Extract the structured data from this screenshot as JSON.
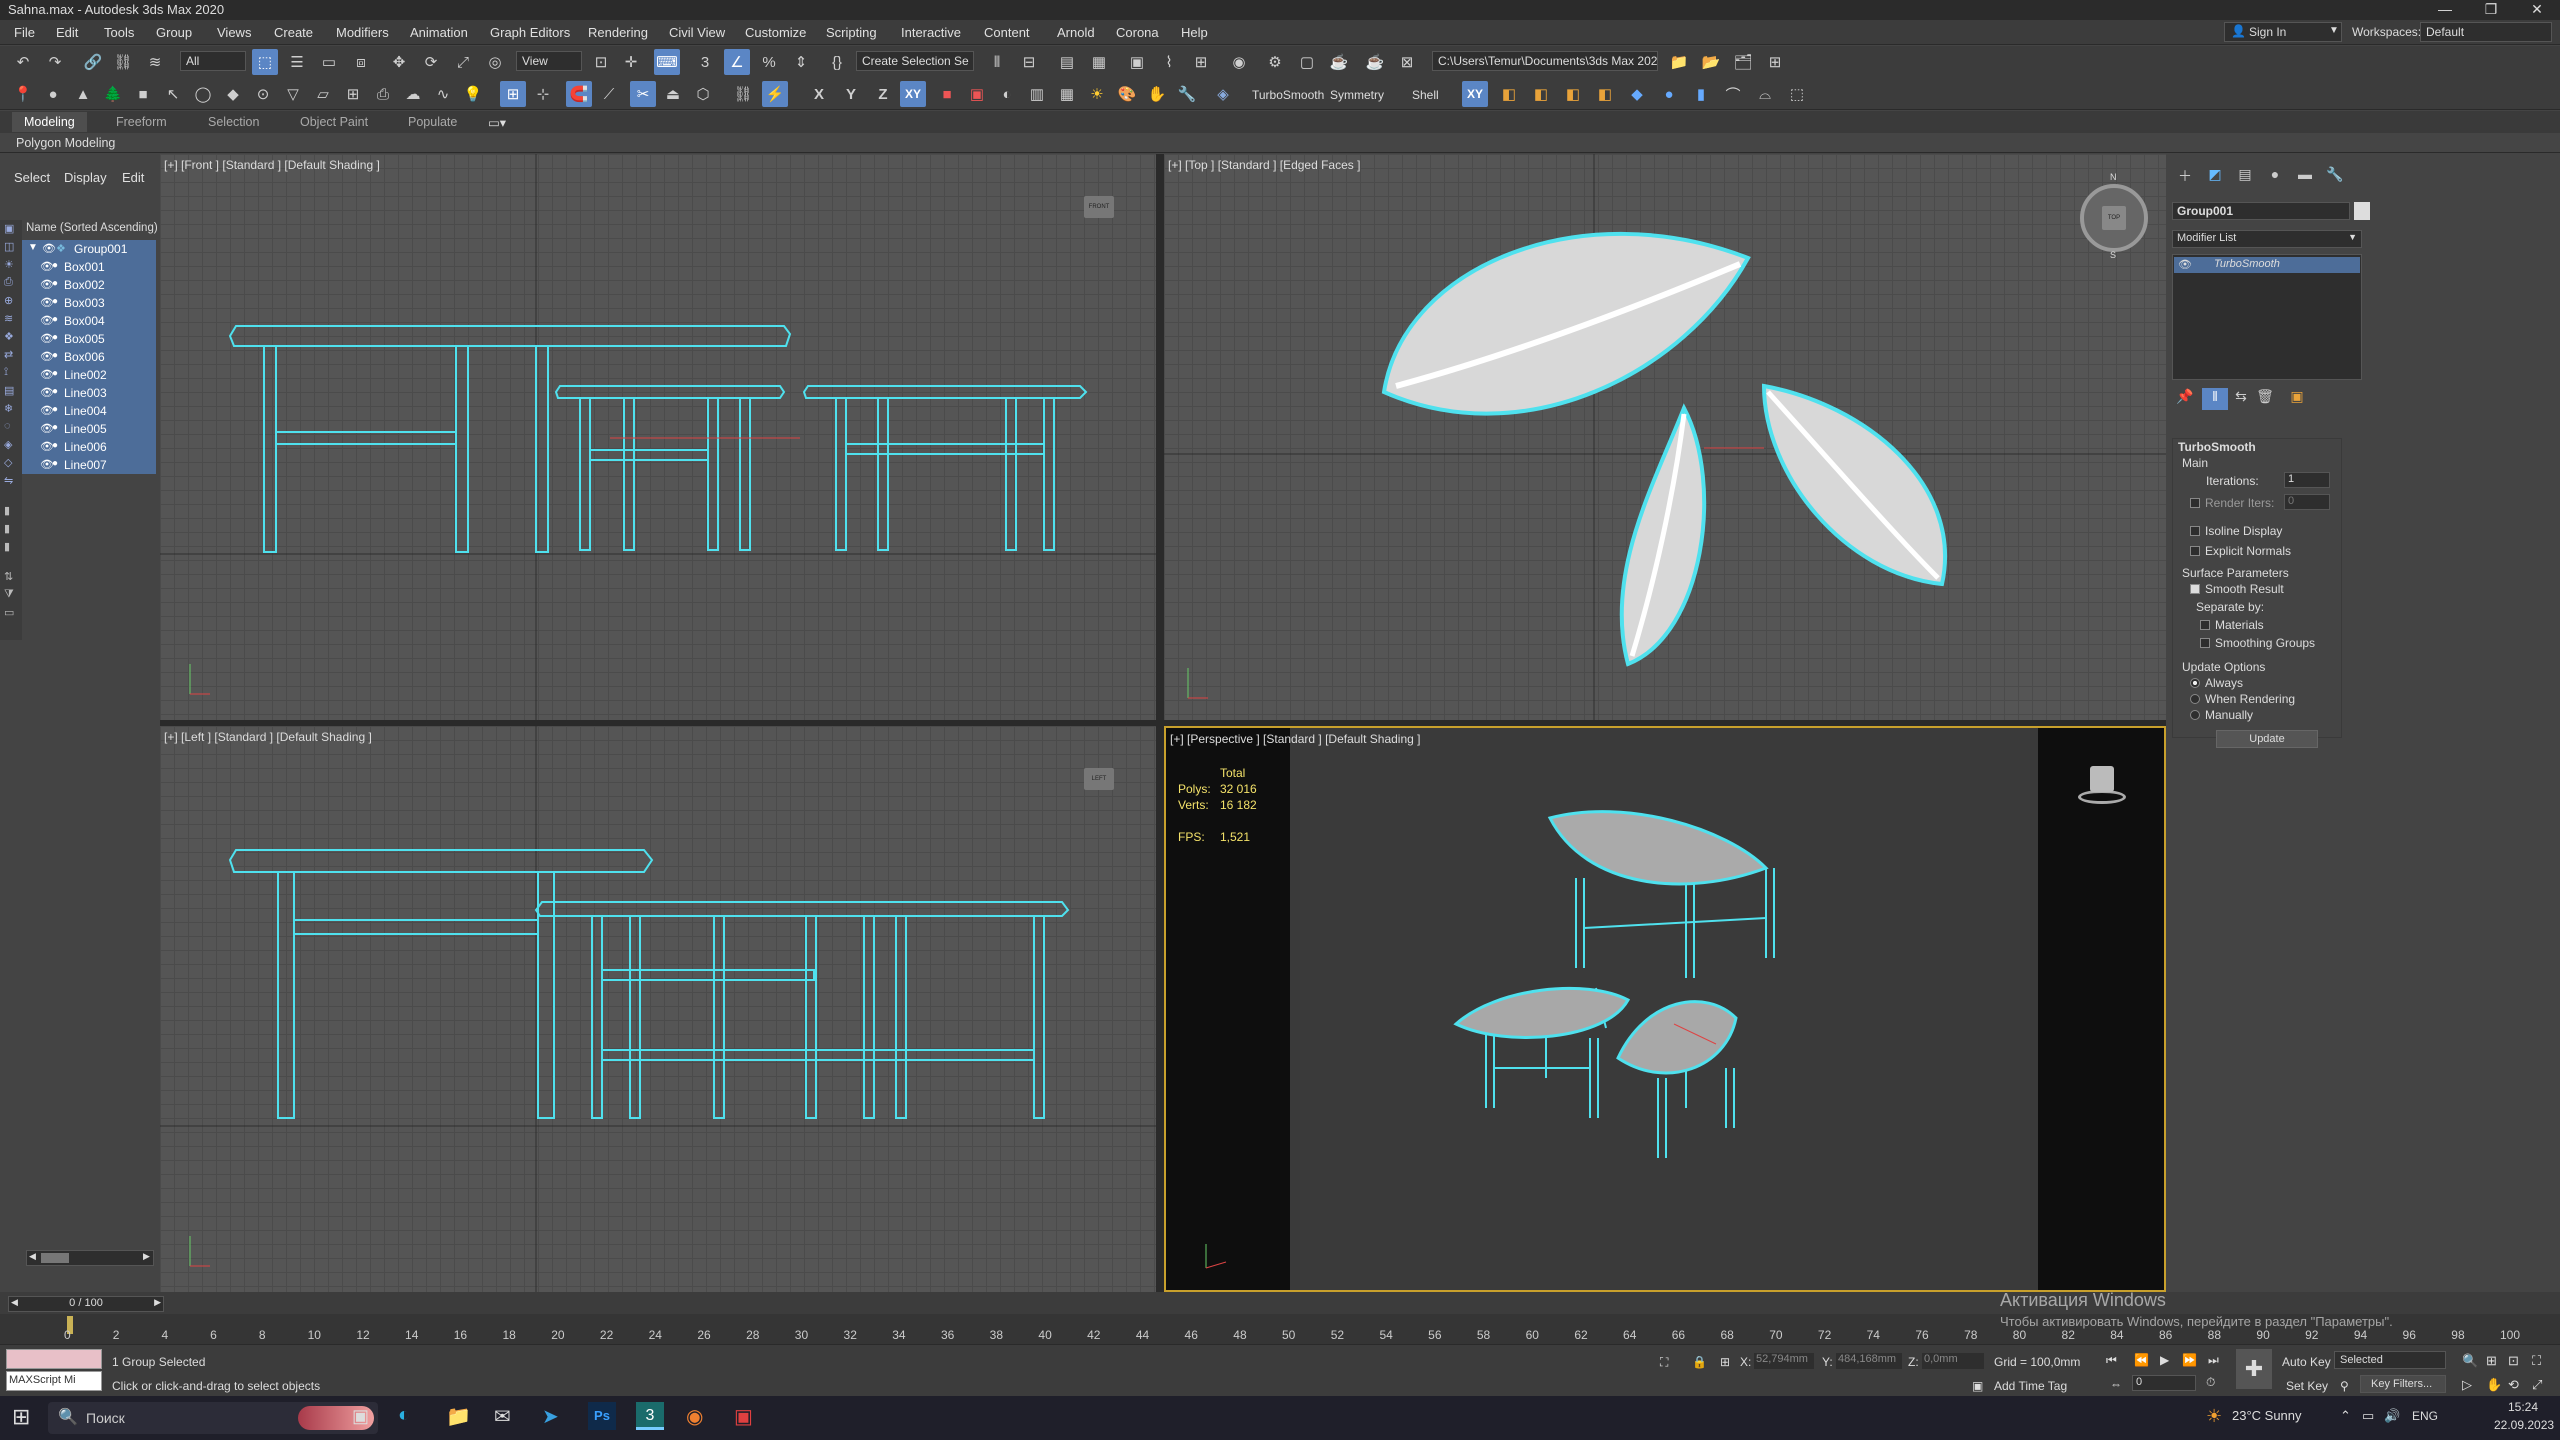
{
  "window": {
    "title": "Sahna.max - Autodesk 3ds Max 2020",
    "min": "—",
    "max": "❐",
    "close": "✕"
  },
  "menus": [
    "File",
    "Edit",
    "Tools",
    "Group",
    "Views",
    "Create",
    "Modifiers",
    "Animation",
    "Graph Editors",
    "Rendering",
    "Civil View",
    "Customize",
    "Scripting",
    "Interactive",
    "Content",
    "Arnold",
    "Corona",
    "Help"
  ],
  "account": {
    "signin": "Sign In",
    "workspaces_label": "Workspaces:",
    "workspace": "Default"
  },
  "toolbar": {
    "filter": "All",
    "refcoord": "View",
    "selset": "Create Selection Se",
    "path": "C:\\Users\\Temur\\Documents\\3ds Max 2020",
    "turbosmooth": "TurboSmooth",
    "symmetry": "Symmetry",
    "shell": "Shell",
    "x": "X",
    "y": "Y",
    "z": "Z",
    "xy": "XY",
    "xy2": "XY"
  },
  "ribbon": {
    "tabs": [
      "Modeling",
      "Freeform",
      "Selection",
      "Object Paint",
      "Populate"
    ],
    "sub": "Polygon Modeling"
  },
  "scene": {
    "tabs": [
      "Select",
      "Display",
      "Edit"
    ],
    "header": "Name (Sorted Ascending)",
    "group": "Group001",
    "items": [
      "Box001",
      "Box002",
      "Box003",
      "Box004",
      "Box005",
      "Box006",
      "Line002",
      "Line003",
      "Line004",
      "Line005",
      "Line006",
      "Line007"
    ]
  },
  "viewports": {
    "front": "[+] [Front ] [Standard ] [Default Shading ]",
    "top": "[+] [Top ] [Standard ] [Edged Faces ]",
    "left": "[+] [Left ] [Standard ] [Default Shading ]",
    "persp": "[+] [Perspective ] [Standard ] [Default Shading ]",
    "front_cube": "FRONT",
    "top_cube": "TOP",
    "left_cube": "LEFT",
    "compass": {
      "n": "N",
      "s": "S",
      "w": "W",
      "e": "E"
    },
    "stats": {
      "total": "Total",
      "polys_label": "Polys:",
      "polys": "32 016",
      "verts_label": "Verts:",
      "verts": "16 182",
      "fps_label": "FPS:",
      "fps": "1,521"
    }
  },
  "command": {
    "object_name": "Group001",
    "modlist": "Modifier List",
    "stack_item": "TurboSmooth",
    "rollout": "TurboSmooth",
    "main": "Main",
    "iterations_label": "Iterations:",
    "iterations": "1",
    "render_iters_label": "Render Iters:",
    "render_iters": "0",
    "isoline": "Isoline Display",
    "explicit": "Explicit Normals",
    "surface": "Surface Parameters",
    "smooth": "Smooth Result",
    "separate": "Separate by:",
    "materials": "Materials",
    "smoothing": "Smoothing Groups",
    "update_opts": "Update Options",
    "always": "Always",
    "when_rendering": "When Rendering",
    "manually": "Manually",
    "update_btn": "Update"
  },
  "timeline": {
    "frame": "0 / 100",
    "ticks": [
      "0",
      "2",
      "4",
      "6",
      "8",
      "10",
      "12",
      "14",
      "16",
      "18",
      "20",
      "22",
      "24",
      "26",
      "28",
      "30",
      "32",
      "34",
      "36",
      "38",
      "40",
      "42",
      "44",
      "46",
      "48",
      "50",
      "52",
      "54",
      "56",
      "58",
      "60",
      "62",
      "64",
      "66",
      "68",
      "70",
      "72",
      "74",
      "76",
      "78",
      "80",
      "82",
      "84",
      "86",
      "88",
      "90",
      "92",
      "94",
      "96",
      "98",
      "100"
    ]
  },
  "status": {
    "selected": "1 Group Selected",
    "hint": "Click or click-and-drag to select objects",
    "maxscript": "MAXScript Mi",
    "x_label": "X:",
    "x": "52,794mm",
    "y_label": "Y:",
    "y": "484,168mm",
    "z_label": "Z:",
    "z": "0,0mm",
    "grid": "Grid = 100,0mm",
    "addtimetag": "Add Time Tag",
    "autokey": "Auto Key",
    "setkey": "Set Key",
    "selected_dd": "Selected",
    "keyfilters": "Key Filters...",
    "frame_field": "0"
  },
  "watermark": {
    "line1": "Активация Windows",
    "line2": "Чтобы активировать Windows, перейдите в раздел \"Параметры\"."
  },
  "taskbar": {
    "search": "Поиск",
    "weather": "23°C  Sunny",
    "lang": "ENG",
    "time": "15:24",
    "date": "22.09.2023"
  }
}
